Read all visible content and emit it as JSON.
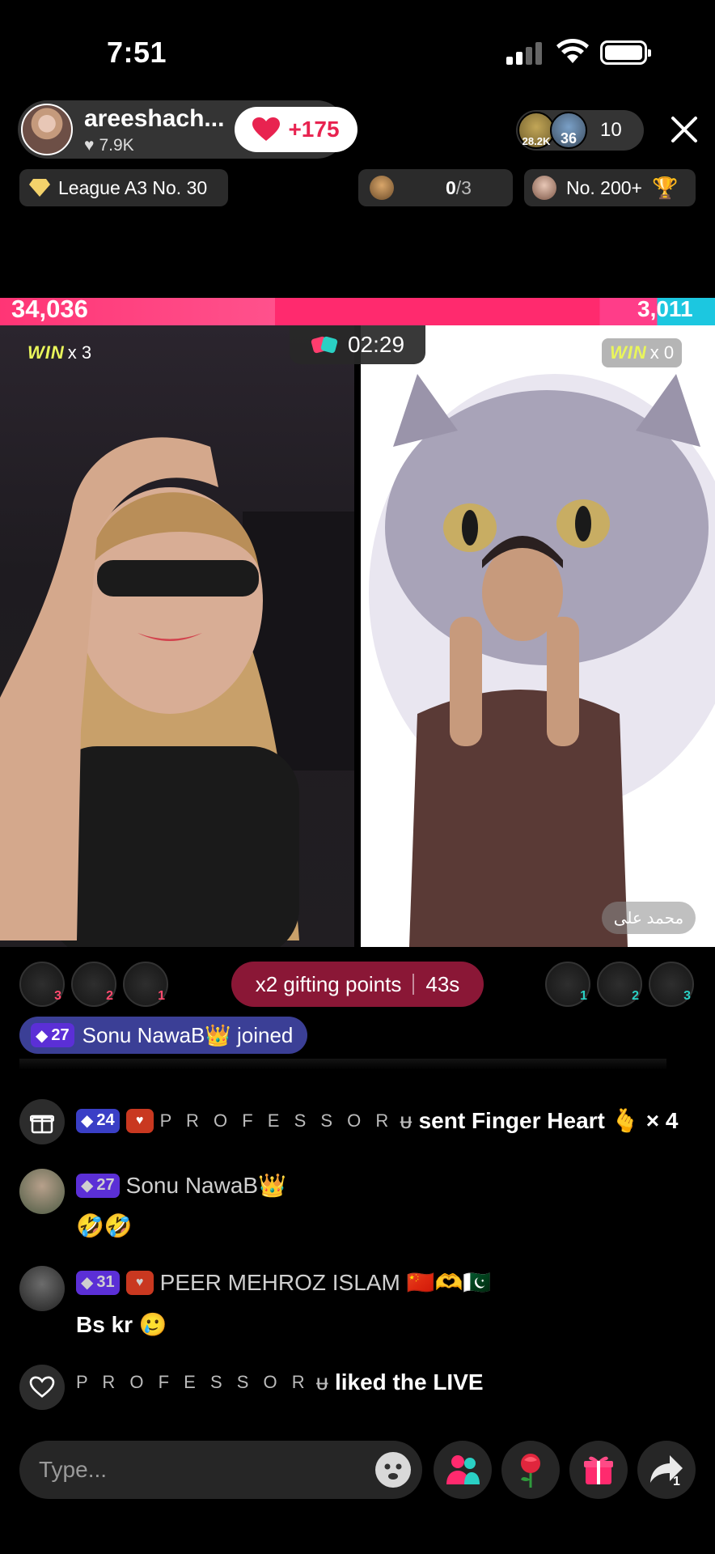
{
  "status_bar": {
    "time": "7:51"
  },
  "host": {
    "name": "areeshach...",
    "likes": "7.9K",
    "like_delta": "+175"
  },
  "viewers": {
    "badge1": "28.2K",
    "badge2": "36",
    "count": "10"
  },
  "chips": {
    "league": "League A3 No. 30",
    "goal_progress": "0",
    "goal_total": "/3",
    "rank": "No. 200+"
  },
  "battle": {
    "left_score": "34,036",
    "right_score": "3,011",
    "timer": "02:29",
    "win_word": "WIN",
    "left_wins": "x 3",
    "right_wins": "x 0",
    "right_name": "محمد علی",
    "left_share": 0.919
  },
  "gifters": {
    "left": [
      "3",
      "2",
      "1"
    ],
    "right": [
      "1",
      "2",
      "3"
    ]
  },
  "bonus": {
    "label": "x2 gifting points",
    "seconds": "43s"
  },
  "joined": {
    "level": "27",
    "text": "Sonu NawaB👑 joined"
  },
  "comments": {
    "gift": {
      "level": "24",
      "user": "P R O F E S S O R ",
      "user_mark": "ᵾ",
      "text": "sent Finger Heart",
      "emoji": "🫰",
      "count": "× 4"
    },
    "c1": {
      "level": "27",
      "user": "Sonu NawaB👑",
      "body": "🤣🤣"
    },
    "c2": {
      "level": "31",
      "user": "PEER MEHROZ ISLAM 🇨🇳🫶🇵🇰",
      "body": "Bs kr 🥲"
    },
    "like": {
      "user": "P R O F E S S O R ",
      "user_mark": "ᵾ",
      "text": "liked the LIVE"
    }
  },
  "input": {
    "placeholder": "Type..."
  },
  "share_count": "1",
  "colors": {
    "battle_left": "#ff2a6e",
    "battle_right": "#1cc7e0",
    "accent": "#e82350"
  }
}
